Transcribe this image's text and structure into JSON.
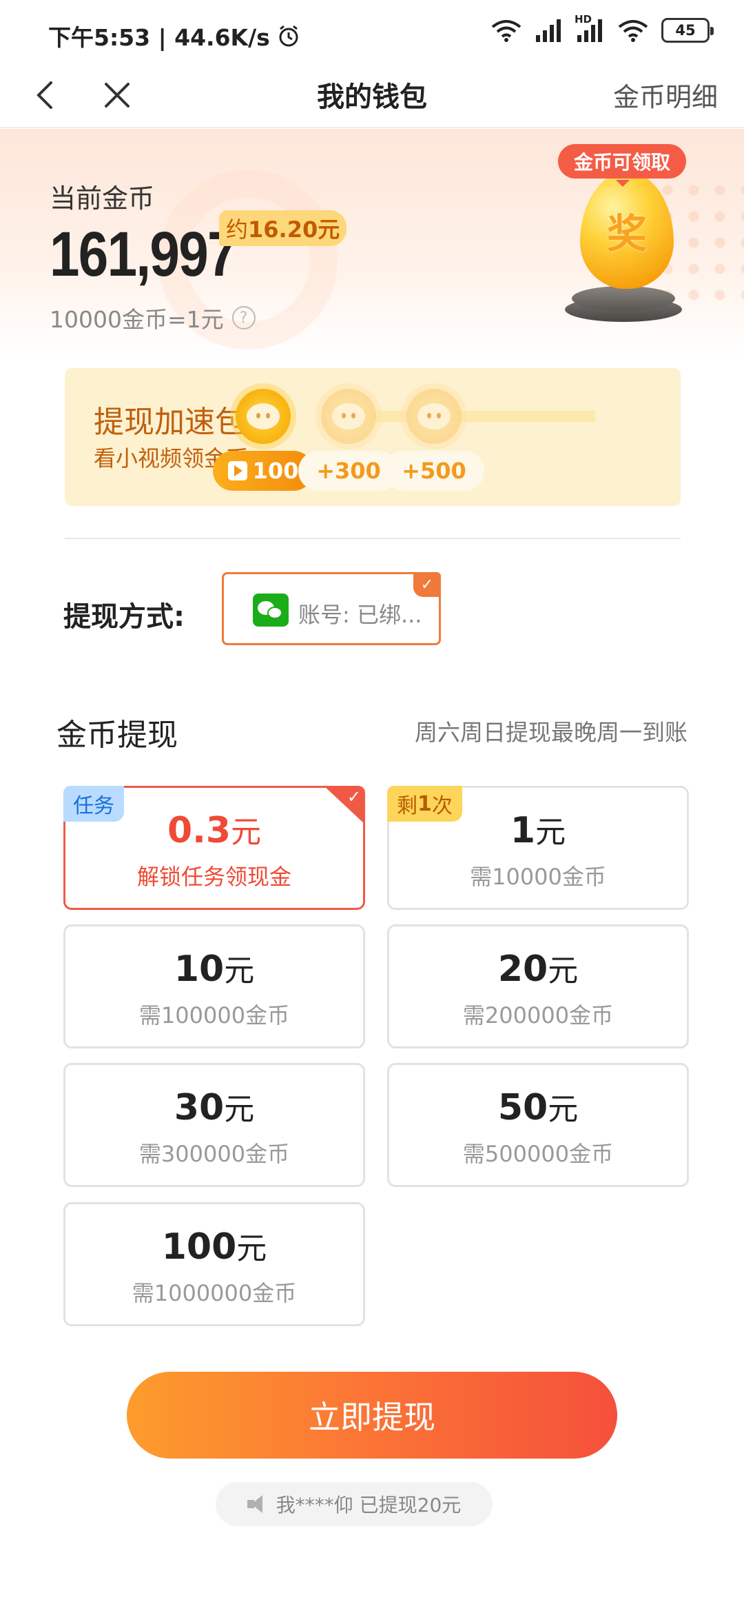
{
  "status_bar": {
    "time_speed": "下午5:53 | 44.6K/s",
    "battery": "45",
    "hd_label": "HD",
    "icons": [
      "alarm-icon",
      "wifi-icon",
      "signal-icon",
      "signal-hd-icon",
      "wifi-icon",
      "battery-icon"
    ]
  },
  "nav": {
    "title": "我的钱包",
    "detail_link": "金币明细",
    "icons": [
      "back-icon",
      "close-icon"
    ]
  },
  "header": {
    "coin_label": "当前金币",
    "coin_amount": "161,997",
    "approx_prefix": "约",
    "approx_value": "16.20元",
    "rate": "10000金币=1元",
    "help_icon": "?",
    "egg_badge": "金币可领取",
    "egg_char": "奖"
  },
  "speed_pack": {
    "title": "提现加速包",
    "subtitle": "看小视频领金币",
    "steps": [
      {
        "label": "100",
        "active": true
      },
      {
        "label": "+300",
        "active": false
      },
      {
        "label": "+500",
        "active": false
      }
    ]
  },
  "withdraw_method": {
    "label": "提现方式:",
    "account_text": "账号: 已绑...",
    "icon": "wechat-icon"
  },
  "coin_withdraw": {
    "title": "金币提现",
    "note": "周六周日提现最晚周一到账",
    "options": [
      {
        "amount": "0.3",
        "unit": "元",
        "sub": "解锁任务领现金",
        "tag": "任务",
        "tag_style": "blue",
        "selected": true
      },
      {
        "amount": "1",
        "unit": "元",
        "sub": "需10000金币",
        "tag_prefix": "剩",
        "tag_bold": "1",
        "tag_suffix": "次",
        "tag_style": "yellow",
        "selected": false
      },
      {
        "amount": "10",
        "unit": "元",
        "sub": "需100000金币",
        "selected": false
      },
      {
        "amount": "20",
        "unit": "元",
        "sub": "需200000金币",
        "selected": false
      },
      {
        "amount": "30",
        "unit": "元",
        "sub": "需300000金币",
        "selected": false
      },
      {
        "amount": "50",
        "unit": "元",
        "sub": "需500000金币",
        "selected": false
      },
      {
        "amount": "100",
        "unit": "元",
        "sub": "需1000000金币",
        "selected": false
      }
    ]
  },
  "submit": {
    "label": "立即提现"
  },
  "ticker": {
    "text": "我****仰 已提现20元"
  },
  "colors": {
    "accent_orange": "#f07a3a",
    "selected_red": "#f05a44",
    "wechat_green": "#1aad19",
    "speed_card_bg": "#fdf1cf"
  }
}
